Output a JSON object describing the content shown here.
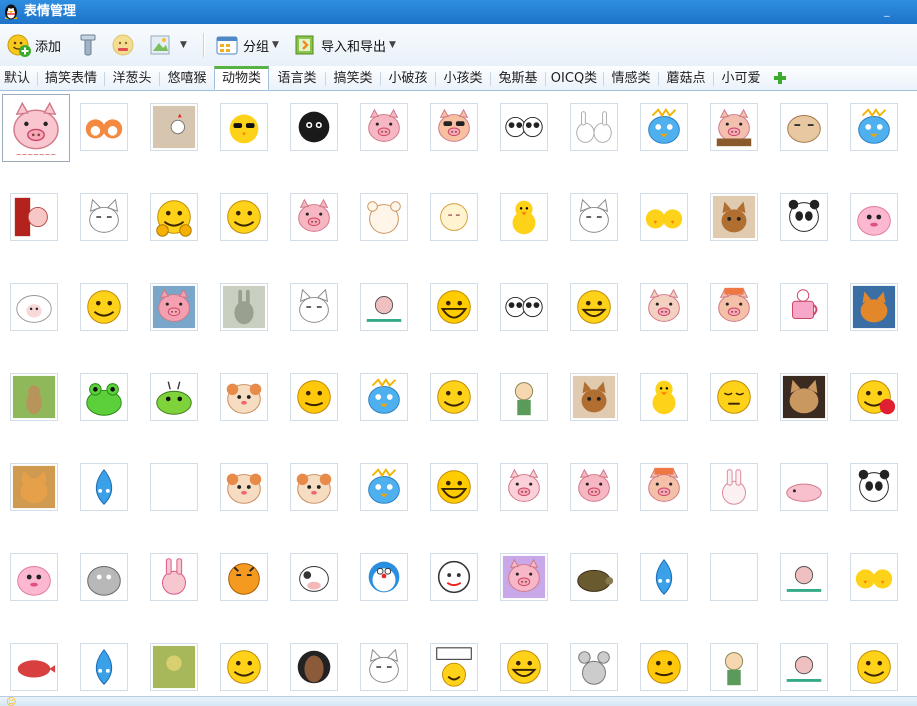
{
  "window": {
    "title": "表情管理"
  },
  "toolbar": {
    "add_label": "添加",
    "group_label": "分组",
    "import_export_label": "导入和导出"
  },
  "tabs": [
    {
      "label": "默认"
    },
    {
      "label": "搞笑表情"
    },
    {
      "label": "洋葱头"
    },
    {
      "label": "悠嘻猴"
    },
    {
      "label": "动物类",
      "active": true
    },
    {
      "label": "语言类"
    },
    {
      "label": "搞笑类"
    },
    {
      "label": "小破孩"
    },
    {
      "label": "小孩类"
    },
    {
      "label": "兔斯基"
    },
    {
      "label": "OICQ类"
    },
    {
      "label": "情感类"
    },
    {
      "label": "蘑菇点"
    },
    {
      "label": "小可爱"
    }
  ],
  "emoticons": [
    {
      "icon": "pink-pig"
    },
    {
      "icon": "fox-pair"
    },
    {
      "icon": "chicken-scene"
    },
    {
      "icon": "chick-sunglasses"
    },
    {
      "icon": "black-fuzzball"
    },
    {
      "icon": "pig-face"
    },
    {
      "icon": "pig-sunglasses"
    },
    {
      "icon": "panda-pair"
    },
    {
      "icon": "bunny-pair"
    },
    {
      "icon": "blue-bird"
    },
    {
      "icon": "pig-desk"
    },
    {
      "icon": "hamster-tired"
    },
    {
      "icon": "blue-bird"
    },
    {
      "icon": "red-door"
    },
    {
      "icon": "white-cat"
    },
    {
      "icon": "smiley-coins"
    },
    {
      "icon": "yellow-smiley"
    },
    {
      "icon": "pig-face"
    },
    {
      "icon": "sketch-bear"
    },
    {
      "icon": "sketch-chick"
    },
    {
      "icon": "yellow-chick"
    },
    {
      "icon": "white-cat"
    },
    {
      "icon": "chick-pair"
    },
    {
      "icon": "kitten-photo"
    },
    {
      "icon": "panda-face"
    },
    {
      "icon": "pink-blob"
    },
    {
      "icon": "white-sheep"
    },
    {
      "icon": "yellow-smiley"
    },
    {
      "icon": "pig-photo"
    },
    {
      "icon": "grey-rabbit"
    },
    {
      "icon": "white-cat"
    },
    {
      "icon": "cartoon-scene"
    },
    {
      "icon": "laughing-smiley"
    },
    {
      "icon": "panda-pair"
    },
    {
      "icon": "grinning-smiley"
    },
    {
      "icon": "pig-small"
    },
    {
      "icon": "pig-hat"
    },
    {
      "icon": "pink-cup"
    },
    {
      "icon": "fox-photo"
    },
    {
      "icon": "cat-grass"
    },
    {
      "icon": "green-frog"
    },
    {
      "icon": "green-caterpillar"
    },
    {
      "icon": "hamster"
    },
    {
      "icon": "winking-smiley"
    },
    {
      "icon": "blue-bird"
    },
    {
      "icon": "yellow-smiley"
    },
    {
      "icon": "cartoon-kid"
    },
    {
      "icon": "kitten-photo"
    },
    {
      "icon": "yellow-chick"
    },
    {
      "icon": "sleepy-smiley"
    },
    {
      "icon": "tabby-cat"
    },
    {
      "icon": "smiley-crab"
    },
    {
      "icon": "cat-photo"
    },
    {
      "icon": "blue-drop"
    },
    {
      "icon": "empty"
    },
    {
      "icon": "hamster"
    },
    {
      "icon": "hamster"
    },
    {
      "icon": "blue-bird"
    },
    {
      "icon": "laughing-smiley"
    },
    {
      "icon": "pink-pig-small"
    },
    {
      "icon": "pig-face"
    },
    {
      "icon": "pig-hat"
    },
    {
      "icon": "white-bunny"
    },
    {
      "icon": "pig-lying"
    },
    {
      "icon": "panda-face"
    },
    {
      "icon": "pink-blob"
    },
    {
      "icon": "grey-blob"
    },
    {
      "icon": "pink-bunny"
    },
    {
      "icon": "orange-tiger"
    },
    {
      "icon": "cow"
    },
    {
      "icon": "doraemon"
    },
    {
      "icon": "cartoon-face"
    },
    {
      "icon": "purple-pig"
    },
    {
      "icon": "turtle"
    },
    {
      "icon": "blue-drop"
    },
    {
      "icon": "empty"
    },
    {
      "icon": "cartoon-scene"
    },
    {
      "icon": "chick-pair"
    },
    {
      "icon": "red-bird"
    },
    {
      "icon": "blue-drop"
    },
    {
      "icon": "garden-photo"
    },
    {
      "icon": "yellow-smiley"
    },
    {
      "icon": "horse-face"
    },
    {
      "icon": "white-cat"
    },
    {
      "icon": "sign-smiley"
    },
    {
      "icon": "grinning-smiley"
    },
    {
      "icon": "grey-mouse"
    },
    {
      "icon": "winking-smiley"
    },
    {
      "icon": "cartoon-kid"
    },
    {
      "icon": "cartoon-scene"
    },
    {
      "icon": "yellow-smiley"
    }
  ],
  "colors": {
    "accent": "#1d73c9",
    "active_tab": "#58b143"
  }
}
